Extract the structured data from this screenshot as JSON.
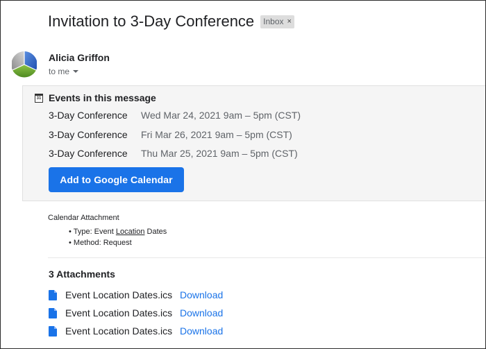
{
  "message": {
    "subject": "Invitation to 3-Day Conference",
    "label": "Inbox",
    "label_remove": "×"
  },
  "sender": {
    "name": "Alicia Griffon",
    "recipient_text": "to me"
  },
  "events": {
    "title": "Events in this message",
    "calendar_icon_text": "31",
    "items": [
      {
        "name": "3-Day Conference",
        "date": "Wed Mar 24, 2021 9am – 5pm (CST)"
      },
      {
        "name": "3-Day Conference",
        "date": "Fri Mar 26, 2021 9am – 5pm (CST)"
      },
      {
        "name": "3-Day Conference",
        "date": "Thu Mar 25, 2021 9am – 5pm (CST)"
      }
    ],
    "add_button_label": "Add to Google Calendar"
  },
  "body": {
    "heading": "Calendar Attachment",
    "bullet_type_prefix": "Type: Event ",
    "bullet_type_link": "Location",
    "bullet_type_suffix": " Dates",
    "bullet_method": "Method: Request"
  },
  "attachments": {
    "title": "3 Attachments",
    "items": [
      {
        "name": "Event Location Dates.ics",
        "action": "Download"
      },
      {
        "name": "Event Location Dates.ics",
        "action": "Download"
      },
      {
        "name": "Event Location Dates.ics",
        "action": "Download"
      }
    ]
  },
  "colors": {
    "accent": "#1a73e8",
    "card_bg": "#f5f5f5",
    "chip_bg": "#dddddd"
  }
}
